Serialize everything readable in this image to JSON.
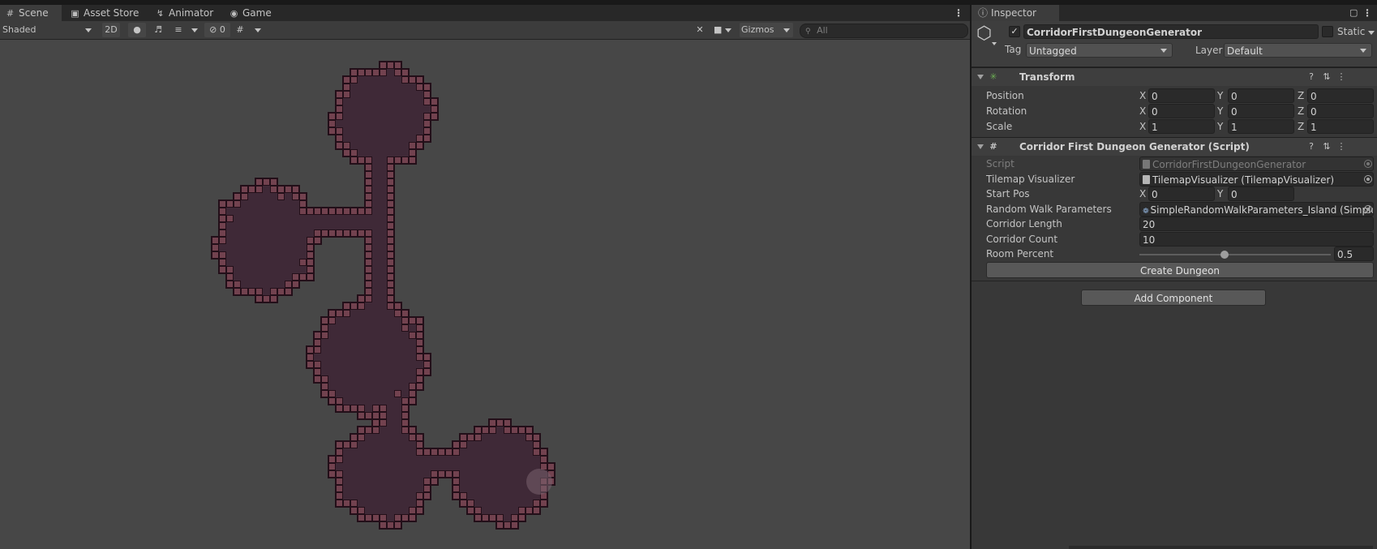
{
  "scene": {
    "tabs": [
      {
        "label": "Scene",
        "icon": "grid-icon"
      },
      {
        "label": "Asset Store",
        "icon": "bag-icon"
      },
      {
        "label": "Animator",
        "icon": "animator-icon"
      },
      {
        "label": "Game",
        "icon": "gamepad-icon"
      }
    ],
    "toolbar": {
      "shading_mode": "Shaded",
      "mode_2d": "2D",
      "hidden_count": "0",
      "gizmos": "Gizmos",
      "search_placeholder": "All"
    },
    "colors": {
      "floor": "#3f2937",
      "wall": "#72424f",
      "border": "#230f19",
      "viewport": "#474747"
    }
  },
  "inspector": {
    "tab": "Inspector",
    "object_name": "CorridorFirstDungeonGenerator",
    "static_label": "Static",
    "tag_label": "Tag",
    "tag_value": "Untagged",
    "layer_label": "Layer",
    "layer_value": "Default",
    "transform": {
      "title": "Transform",
      "rows": [
        {
          "label": "Position",
          "x": "0",
          "y": "0",
          "z": "0"
        },
        {
          "label": "Rotation",
          "x": "0",
          "y": "0",
          "z": "0"
        },
        {
          "label": "Scale",
          "x": "1",
          "y": "1",
          "z": "1"
        }
      ]
    },
    "script_component": {
      "title": "Corridor First Dungeon Generator (Script)",
      "script_label": "Script",
      "script_value": "CorridorFirstDungeonGenerator",
      "tilemap_label": "Tilemap Visualizer",
      "tilemap_value": "TilemapVisualizer (TilemapVisualizer)",
      "start_pos_label": "Start Pos",
      "start_x": "0",
      "start_y": "0",
      "random_walk_label": "Random Walk Parameters",
      "random_walk_value": "SimpleRandomWalkParameters_Island (Simple",
      "corridor_length_label": "Corridor Length",
      "corridor_length": "20",
      "corridor_count_label": "Corridor Count",
      "corridor_count": "10",
      "room_percent_label": "Room Percent",
      "room_percent": "0.5",
      "create_button": "Create Dungeon"
    },
    "add_component": "Add Component"
  }
}
